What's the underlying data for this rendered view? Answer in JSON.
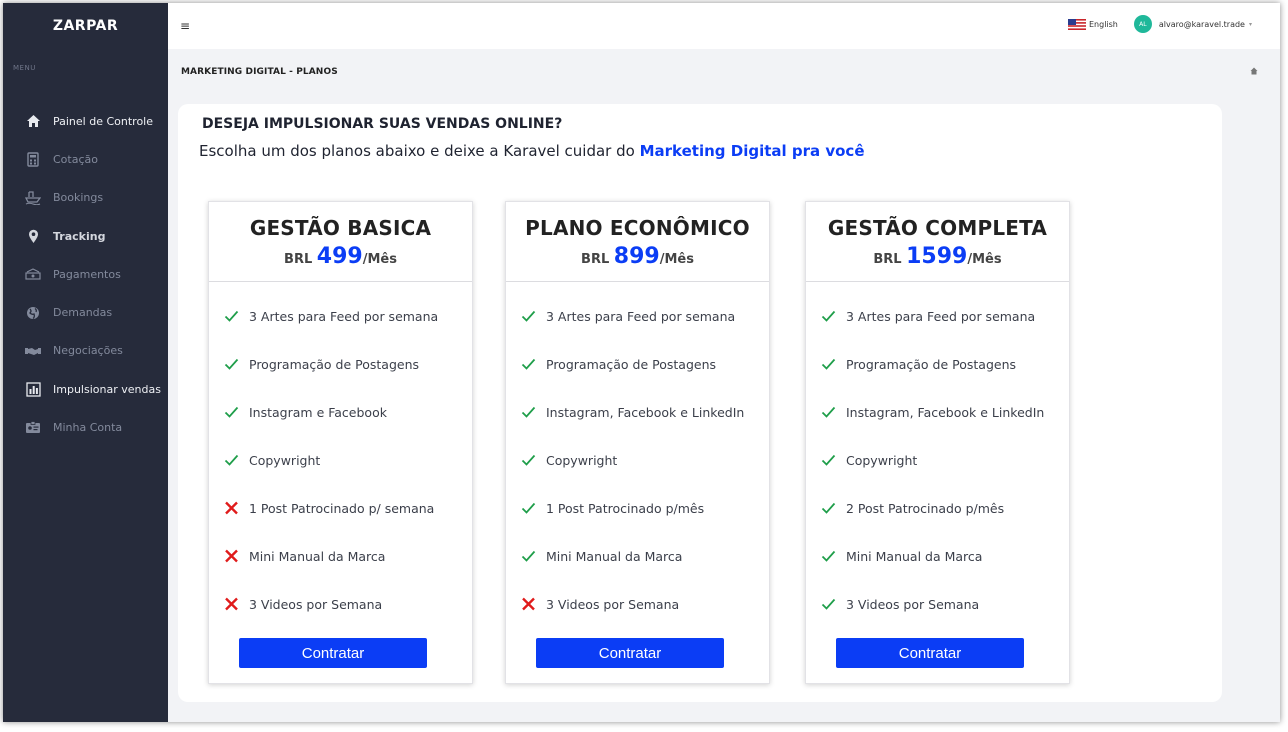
{
  "app": {
    "brand": "ZARPAR",
    "menu_title": "MENU"
  },
  "sidebar": {
    "items": [
      {
        "label": "Painel de Controle",
        "icon": "home-icon"
      },
      {
        "label": "Cotação",
        "icon": "calculator-icon"
      },
      {
        "label": "Bookings",
        "icon": "ship-icon"
      },
      {
        "label": "Tracking",
        "icon": "map-marker-icon"
      },
      {
        "label": "Pagamentos",
        "icon": "money-icon"
      },
      {
        "label": "Demandas",
        "icon": "globe-icon"
      },
      {
        "label": "Negociações",
        "icon": "handshake-icon"
      },
      {
        "label": "Impulsionar vendas",
        "icon": "bar-chart-icon"
      },
      {
        "label": "Minha Conta",
        "icon": "id-card-icon"
      }
    ]
  },
  "topbar": {
    "menu_icon": "≡",
    "language": "English",
    "avatar_initials": "AL",
    "user_email": "alvaro@karavel.trade"
  },
  "breadcrumb": "MARKETING DIGITAL -  PLANOS",
  "hero": {
    "heading": "DESEJA IMPULSIONAR SUAS VENDAS ONLINE?",
    "subheading": "Escolha um dos planos abaixo e deixe a Karavel cuidar do ",
    "subheading_accent": "Marketing Digital pra você"
  },
  "colors": {
    "accent": "#0b3df5",
    "check": "#1f9e4a",
    "cross": "#e01b1b",
    "sidebar": "#262b3b"
  },
  "plans": [
    {
      "name": "GESTÃO BASICA",
      "currency": "BRL ",
      "price": "499",
      "period": "/Mês",
      "button": "Contratar",
      "features": [
        {
          "text": "3 Artes para Feed por semana",
          "included": true
        },
        {
          "text": "Programação de Postagens",
          "included": true
        },
        {
          "text": "Instagram e Facebook",
          "included": true
        },
        {
          "text": "Copywright",
          "included": true
        },
        {
          "text": "1 Post Patrocinado p/ semana",
          "included": false
        },
        {
          "text": "Mini Manual da Marca",
          "included": false
        },
        {
          "text": "3 Videos por Semana",
          "included": false
        }
      ]
    },
    {
      "name": "PLANO ECONÔMICO",
      "currency": "BRL ",
      "price": "899",
      "period": "/Mês",
      "button": "Contratar",
      "features": [
        {
          "text": "3 Artes para Feed por semana",
          "included": true
        },
        {
          "text": "Programação de Postagens",
          "included": true
        },
        {
          "text": "Instagram, Facebook e LinkedIn",
          "included": true
        },
        {
          "text": "Copywright",
          "included": true
        },
        {
          "text": "1 Post Patrocinado p/mês",
          "included": true
        },
        {
          "text": "Mini Manual da Marca",
          "included": true
        },
        {
          "text": "3 Videos por Semana",
          "included": false
        }
      ]
    },
    {
      "name": "GESTÃO COMPLETA",
      "currency": "BRL ",
      "price": "1599",
      "period": "/Mês",
      "button": "Contratar",
      "features": [
        {
          "text": "3 Artes para Feed por semana",
          "included": true
        },
        {
          "text": "Programação de Postagens",
          "included": true
        },
        {
          "text": "Instagram, Facebook e LinkedIn",
          "included": true
        },
        {
          "text": "Copywright",
          "included": true
        },
        {
          "text": "2 Post Patrocinado p/mês",
          "included": true
        },
        {
          "text": "Mini Manual da Marca",
          "included": true
        },
        {
          "text": "3 Videos por Semana",
          "included": true
        }
      ]
    }
  ]
}
